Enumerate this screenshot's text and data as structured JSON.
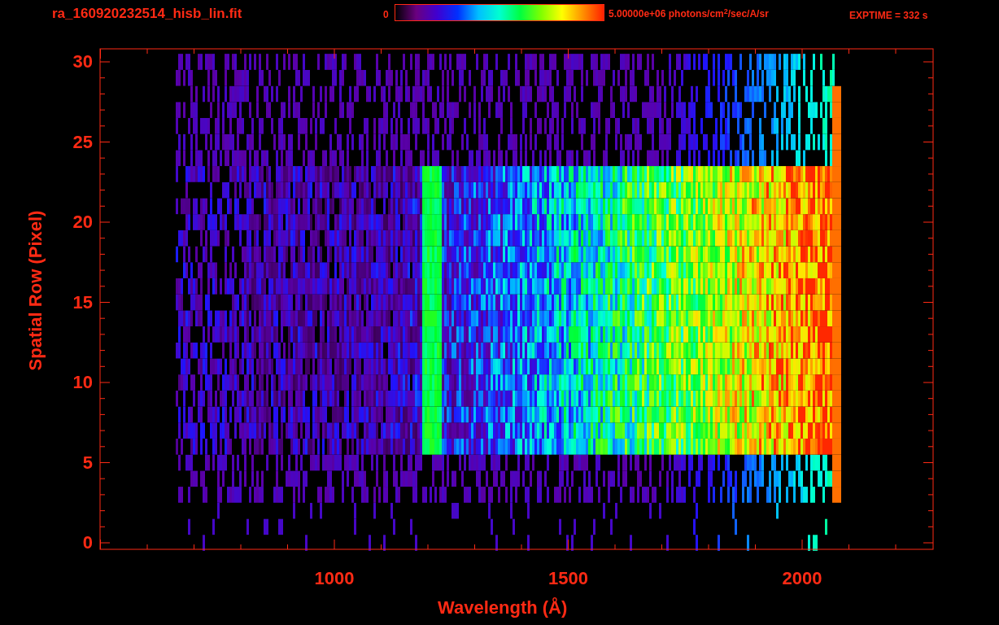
{
  "title": "ra_160920232514_hisb_lin.fit",
  "colorbar": {
    "min_label": "0",
    "max_label": "5.00000e+06 photons/cm$^{2}$/sec/A/sr"
  },
  "exposure": "EXPTIME = 332 s",
  "plot": {
    "xlabel": "Wavelength (Å)",
    "ylabel": "Spatial Row (Pixel)",
    "xticks": [
      "1000",
      "1500",
      "2000"
    ],
    "yticks": [
      "30",
      "25",
      "20",
      "15",
      "10",
      "5",
      "0"
    ]
  }
}
